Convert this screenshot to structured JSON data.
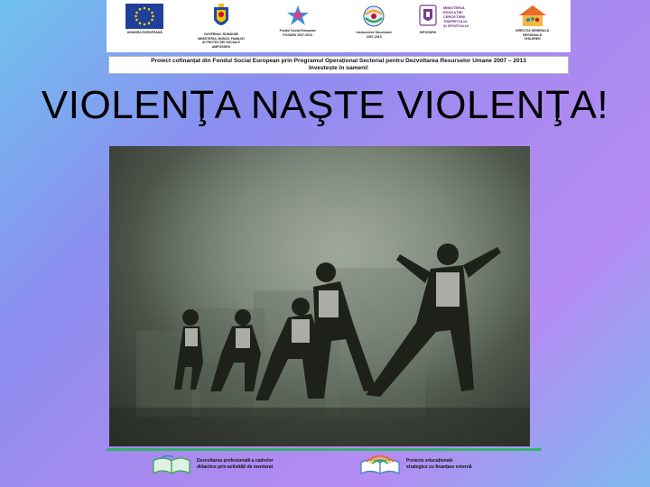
{
  "logos": [
    {
      "icon": "eu-flag-icon",
      "caption": "UNIUNEA EUROPEANĂ"
    },
    {
      "icon": "romania-coat-of-arms-icon",
      "caption": "GUVERNUL ROMÂNIEI\nMINISTERUL MUNCII, FAMILIEI\nȘI PROTECȚIEI SOCIALE\nAMPOSDRU"
    },
    {
      "icon": "fse-logo-icon",
      "caption": "Fondul Social European\nPOSDRU 2007-2013"
    },
    {
      "icon": "instrumente-structurale-icon",
      "caption": "Instrumente Structurale\n2007-2013"
    },
    {
      "icon": "ministry-crest-icon",
      "caption": "OIPOSDRU"
    },
    {
      "icon": "house-family-icon",
      "caption": "DIRECȚIA GENERALĂ\nREGIONALĂ\nCHILDREN"
    }
  ],
  "ministry_text": "MINISTERUL\nEDUCAȚIEI\nCERCETĂRII\nTINERETULUI\nȘI SPORTULUI",
  "banner": {
    "line1": "Proiect cofinanțat din Fondul Social European prin Programul Operațional Sectorial pentru Dezvoltarea Resurselor Umane 2007 – 2013",
    "line2": "Investește în oameni!"
  },
  "title": "VIOLENŢA NAŞTE VIOLENŢA!",
  "footer": [
    {
      "icon": "open-book-icon",
      "text": "Dezvoltarea profesională a cadrelor\ndidactice prin activități de mentorat"
    },
    {
      "icon": "open-book-rainbow-icon",
      "text": "Proiecte educaționale\nstrategice cu finanțare externă"
    }
  ],
  "colors": {
    "banner_border": "#b9b9b9",
    "footer_line": "#33b26a"
  }
}
